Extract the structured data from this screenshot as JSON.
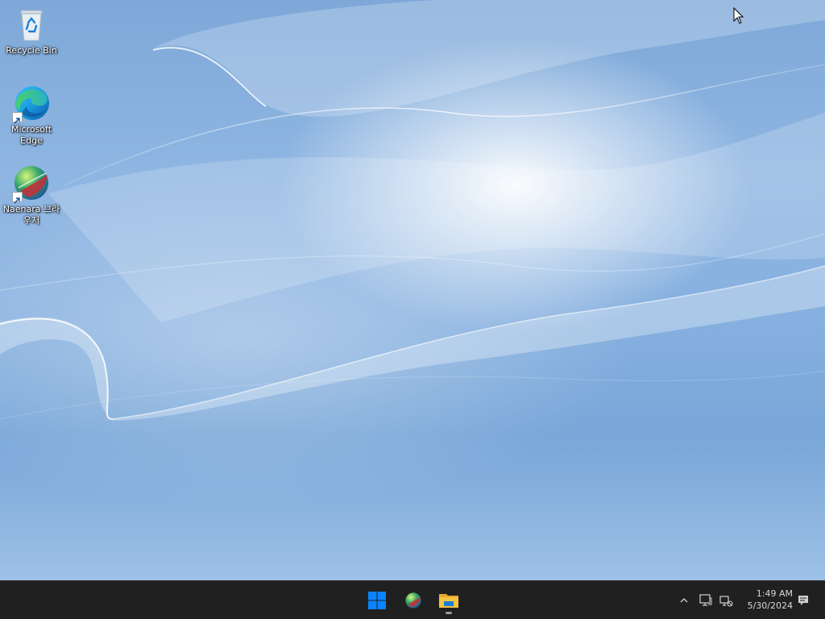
{
  "desktop": {
    "icons": [
      {
        "label": "Recycle Bin",
        "icon": "recycle-bin-icon"
      },
      {
        "label": "Microsoft Edge",
        "icon": "edge-icon",
        "shortcut": true
      },
      {
        "label": "Naenara 브라우저",
        "icon": "naenara-browser-icon",
        "shortcut": true
      }
    ]
  },
  "taskbar": {
    "pinned": [
      {
        "name": "start-button",
        "icon": "windows-logo-icon"
      },
      {
        "name": "naenara-browser-taskbar-button",
        "icon": "naenara-browser-icon"
      },
      {
        "name": "file-explorer-taskbar-button",
        "icon": "folder-icon",
        "running": true
      }
    ],
    "tray": {
      "icons": [
        "chevron-up-icon",
        "display-icon",
        "network-icon",
        "notification-icon"
      ],
      "time": "1:49 AM",
      "date": "5/30/2024"
    }
  },
  "colors": {
    "taskbar_bg": "#202020",
    "windows_blue": "#0a84ff",
    "folder_yellow": "#f5c242"
  }
}
